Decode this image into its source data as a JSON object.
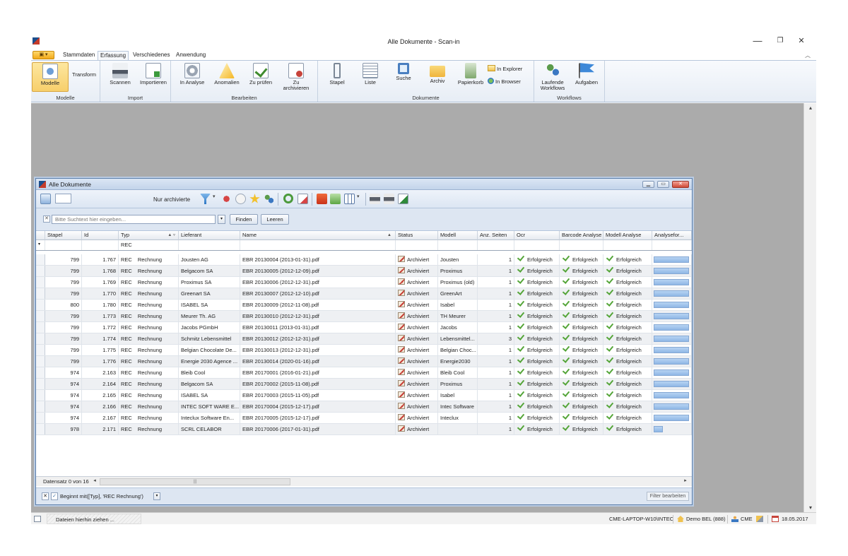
{
  "window": {
    "title": "Alle Dokumente - Scan-in",
    "minimize": "—",
    "maximize": "❐",
    "close": "✕"
  },
  "ribbon_tabs": [
    {
      "label": "Stammdaten"
    },
    {
      "label": "Erfassung"
    },
    {
      "label": "Verschiedenes"
    },
    {
      "label": "Anwendung"
    }
  ],
  "active_tab": "Erfassung",
  "ribbon": {
    "groups": {
      "modelle": "Modelle",
      "import": "Import",
      "bearbeiten": "Bearbeiten",
      "dokumente": "Dokumente",
      "workflows": "Workflows"
    },
    "buttons": {
      "modelle": "Modelle",
      "transform": "Transform",
      "scannen": "Scannen",
      "importieren": "Importieren",
      "in_analyse": "In Analyse",
      "anomalien": "Anomalien",
      "zu_pruefen": "Zu prüfen",
      "zu_archivieren_1": "Zu",
      "zu_archivieren_2": "archivieren",
      "stapel": "Stapel",
      "liste": "Liste",
      "suche": "Suche",
      "archiv": "Archiv",
      "papierkorb": "Papierkorb",
      "in_explorer": "In Explorer",
      "in_browser": "In Browser",
      "laufende_workflows_1": "Laufende",
      "laufende_workflows_2": "Workflows",
      "aufgaben": "Aufgaben"
    }
  },
  "document_window": {
    "title": "Alle Dokumente",
    "nur_archivierte": "Nur archivierte",
    "search_placeholder": "Bitte Suchtext hier eingeben...",
    "finden": "Finden",
    "leeren": "Leeren"
  },
  "grid": {
    "columns": [
      "Stapel",
      "Id",
      "Typ",
      "Lieferant",
      "Name",
      "Status",
      "Modell",
      "Anz. Seiten",
      "Ocr",
      "Barcode Analyse",
      "Modell Analyse",
      "Analysefor..."
    ],
    "filter_typ": "REC",
    "rows": [
      {
        "stapel": "799",
        "id": "1.767",
        "typ": "REC",
        "typ2": "Rechnung",
        "lieferant": "Jousten AG",
        "name": "EBR 20130004 (2013-01-31).pdf",
        "status": "Archiviert",
        "modell": "Jousten",
        "seiten": "1",
        "ocr": "Erfolgreich",
        "barcode": "Erfolgreich",
        "modell_analyse": "Erfolgreich",
        "progress": 1.0
      },
      {
        "stapel": "799",
        "id": "1.768",
        "typ": "REC",
        "typ2": "Rechnung",
        "lieferant": "Belgacom SA",
        "name": "EBR 20130005 (2012-12-09).pdf",
        "status": "Archiviert",
        "modell": "Proximus",
        "seiten": "1",
        "ocr": "Erfolgreich",
        "barcode": "Erfolgreich",
        "modell_analyse": "Erfolgreich",
        "progress": 1.0
      },
      {
        "stapel": "799",
        "id": "1.769",
        "typ": "REC",
        "typ2": "Rechnung",
        "lieferant": "Proximus SA",
        "name": "EBR 20130006 (2012-12-31).pdf",
        "status": "Archiviert",
        "modell": "Proximus (old)",
        "seiten": "1",
        "ocr": "Erfolgreich",
        "barcode": "Erfolgreich",
        "modell_analyse": "Erfolgreich",
        "progress": 1.0
      },
      {
        "stapel": "799",
        "id": "1.770",
        "typ": "REC",
        "typ2": "Rechnung",
        "lieferant": "Greenart SA",
        "name": "EBR 20130007 (2012-12-10).pdf",
        "status": "Archiviert",
        "modell": "GreenArt",
        "seiten": "1",
        "ocr": "Erfolgreich",
        "barcode": "Erfolgreich",
        "modell_analyse": "Erfolgreich",
        "progress": 1.0
      },
      {
        "stapel": "800",
        "id": "1.780",
        "typ": "REC",
        "typ2": "Rechnung",
        "lieferant": "ISABEL SA",
        "name": "EBR 20130009 (2012-11-08).pdf",
        "status": "Archiviert",
        "modell": "Isabel",
        "seiten": "1",
        "ocr": "Erfolgreich",
        "barcode": "Erfolgreich",
        "modell_analyse": "Erfolgreich",
        "progress": 1.0
      },
      {
        "stapel": "799",
        "id": "1.773",
        "typ": "REC",
        "typ2": "Rechnung",
        "lieferant": "Meurer Th. AG",
        "name": "EBR 20130010 (2012-12-31).pdf",
        "status": "Archiviert",
        "modell": "TH Meurer",
        "seiten": "1",
        "ocr": "Erfolgreich",
        "barcode": "Erfolgreich",
        "modell_analyse": "Erfolgreich",
        "progress": 1.0
      },
      {
        "stapel": "799",
        "id": "1.772",
        "typ": "REC",
        "typ2": "Rechnung",
        "lieferant": "Jacobs PGmbH",
        "name": "EBR 20130011 (2013-01-31).pdf",
        "status": "Archiviert",
        "modell": "Jacobs",
        "seiten": "1",
        "ocr": "Erfolgreich",
        "barcode": "Erfolgreich",
        "modell_analyse": "Erfolgreich",
        "progress": 1.0
      },
      {
        "stapel": "799",
        "id": "1.774",
        "typ": "REC",
        "typ2": "Rechnung",
        "lieferant": "Schmitz Lebensmittel",
        "name": "EBR 20130012 (2012-12-31).pdf",
        "status": "Archiviert",
        "modell": "Lebensmittel...",
        "seiten": "3",
        "ocr": "Erfolgreich",
        "barcode": "Erfolgreich",
        "modell_analyse": "Erfolgreich",
        "progress": 1.0
      },
      {
        "stapel": "799",
        "id": "1.775",
        "typ": "REC",
        "typ2": "Rechnung",
        "lieferant": "Belgian Chocolate De...",
        "name": "EBR 20130013 (2012-12-31).pdf",
        "status": "Archiviert",
        "modell": "Belgian Choc...",
        "seiten": "1",
        "ocr": "Erfolgreich",
        "barcode": "Erfolgreich",
        "modell_analyse": "Erfolgreich",
        "progress": 1.0
      },
      {
        "stapel": "799",
        "id": "1.776",
        "typ": "REC",
        "typ2": "Rechnung",
        "lieferant": "Energie 2030 Agence ...",
        "name": "EBR 20130014 (2020-01-16).pdf",
        "status": "Archiviert",
        "modell": "Energie2030",
        "seiten": "1",
        "ocr": "Erfolgreich",
        "barcode": "Erfolgreich",
        "modell_analyse": "Erfolgreich",
        "progress": 1.0
      },
      {
        "stapel": "974",
        "id": "2.163",
        "typ": "REC",
        "typ2": "Rechnung",
        "lieferant": "Bleib Cool",
        "name": "EBR 20170001 (2016-01-21).pdf",
        "status": "Archiviert",
        "modell": "Bleib Cool",
        "seiten": "1",
        "ocr": "Erfolgreich",
        "barcode": "Erfolgreich",
        "modell_analyse": "Erfolgreich",
        "progress": 1.0
      },
      {
        "stapel": "974",
        "id": "2.164",
        "typ": "REC",
        "typ2": "Rechnung",
        "lieferant": "Belgacom SA",
        "name": "EBR 20170002 (2015-11-08).pdf",
        "status": "Archiviert",
        "modell": "Proximus",
        "seiten": "1",
        "ocr": "Erfolgreich",
        "barcode": "Erfolgreich",
        "modell_analyse": "Erfolgreich",
        "progress": 1.0
      },
      {
        "stapel": "974",
        "id": "2.165",
        "typ": "REC",
        "typ2": "Rechnung",
        "lieferant": "ISABEL SA",
        "name": "EBR 20170003 (2015-11-05).pdf",
        "status": "Archiviert",
        "modell": "Isabel",
        "seiten": "1",
        "ocr": "Erfolgreich",
        "barcode": "Erfolgreich",
        "modell_analyse": "Erfolgreich",
        "progress": 1.0
      },
      {
        "stapel": "974",
        "id": "2.166",
        "typ": "REC",
        "typ2": "Rechnung",
        "lieferant": "INTEC SOFT WARE E...",
        "name": "EBR 20170004 (2015-12-17).pdf",
        "status": "Archiviert",
        "modell": "Intec Software",
        "seiten": "1",
        "ocr": "Erfolgreich",
        "barcode": "Erfolgreich",
        "modell_analyse": "Erfolgreich",
        "progress": 1.0
      },
      {
        "stapel": "974",
        "id": "2.167",
        "typ": "REC",
        "typ2": "Rechnung",
        "lieferant": "Inteclux Software En...",
        "name": "EBR 20170005 (2015-12-17).pdf",
        "status": "Archiviert",
        "modell": "Inteclux",
        "seiten": "1",
        "ocr": "Erfolgreich",
        "barcode": "Erfolgreich",
        "modell_analyse": "Erfolgreich",
        "progress": 1.0
      },
      {
        "stapel": "978",
        "id": "2.171",
        "typ": "REC",
        "typ2": "Rechnung",
        "lieferant": "SCRL CELABOR",
        "name": "EBR 20170006 (2017-01-31).pdf",
        "status": "Archiviert",
        "modell": "",
        "seiten": "1",
        "ocr": "Erfolgreich",
        "barcode": "Erfolgreich",
        "modell_analyse": "Erfolgreich",
        "progress": 0.25
      }
    ],
    "footer_record": "Datensatz 0 von 16",
    "filter_expression": "Beginnt mit([Typ], 'REC   Rechnung')",
    "filter_edit": "Filter bearbeiten"
  },
  "statusbar": {
    "drop_hint": "Dateien hierhin ziehen ...",
    "machine": "CME-LAPTOP-W10\\INTEC",
    "company": "Demo BEL (888)",
    "user": "CME",
    "date": "18.05.2017"
  },
  "colors": {
    "accent": "#3d88d8",
    "success": "#54a538",
    "workspace": "#ababab"
  }
}
